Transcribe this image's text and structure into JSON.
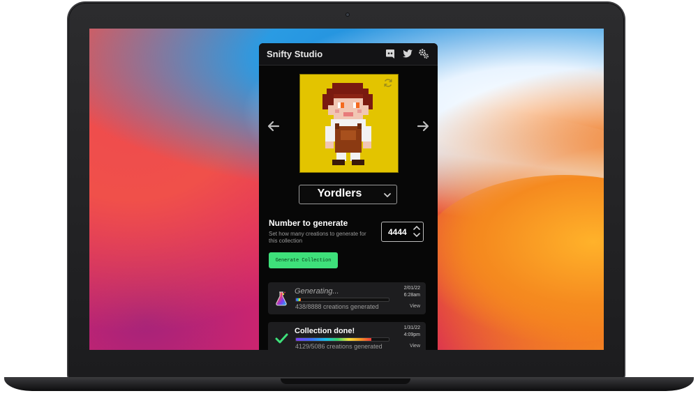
{
  "app": {
    "title": "Snifty Studio",
    "header_icons": [
      "discord-icon",
      "twitter-icon",
      "settings-icon"
    ]
  },
  "preview": {
    "background_color": "#e3c400",
    "icons": [
      "refresh-icon",
      "arrow-left-icon",
      "arrow-right-icon"
    ]
  },
  "collection_select": {
    "value": "Yordlers"
  },
  "generate": {
    "title": "Number to generate",
    "description": "Set how many creations to generate for this collection",
    "count": "4444",
    "button_label": "Generate Collection",
    "button_color": "#3ee07a"
  },
  "jobs": [
    {
      "status": "Generating...",
      "progress": 0.05,
      "count_text": "438/8888 creations generated",
      "date": "2/01/22",
      "time": "6:28am",
      "view_label": "View",
      "icon": "flask-icon"
    },
    {
      "status": "Collection done!",
      "progress": 0.81,
      "count_text": "4129/5086 creations generated",
      "date": "1/31/22",
      "time": "4:09pm",
      "view_label": "View",
      "icon": "check-icon"
    }
  ]
}
